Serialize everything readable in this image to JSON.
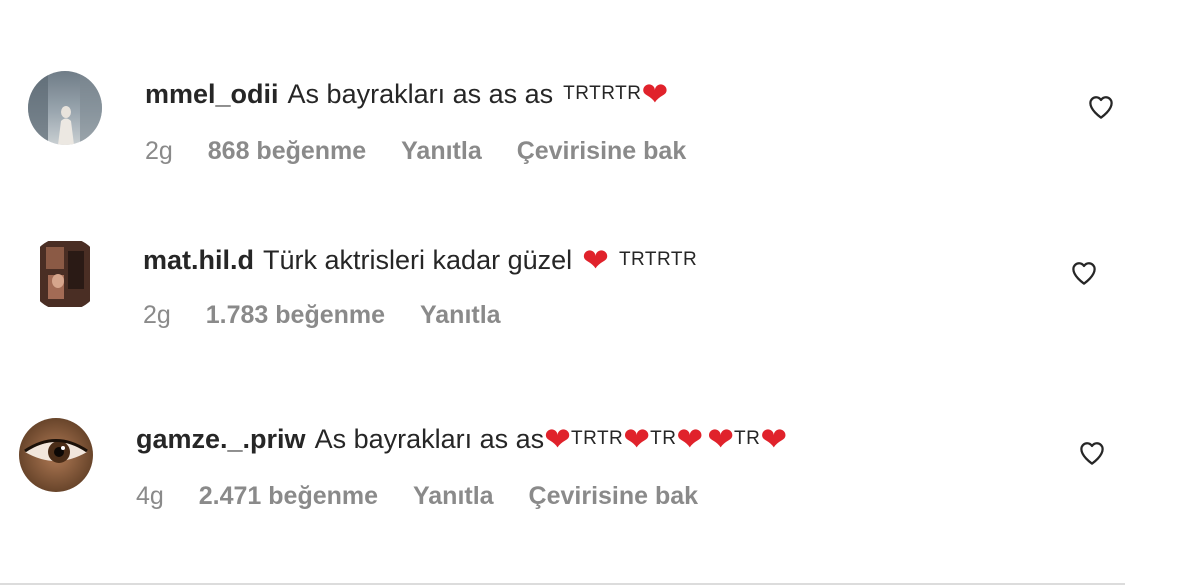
{
  "comments": [
    {
      "username": "mmel_odii",
      "text": "As bayrakları as as as",
      "tr_label": "TRTRTR",
      "time": "2g",
      "likes": "868 beğenme",
      "reply": "Yanıtla",
      "translate": "Çevirisine bak",
      "avatar_icon": "profile-photo-avatar"
    },
    {
      "username": "mat.hil.d",
      "text": "Türk aktrisleri kadar güzel",
      "tr_label": "TRTRTR",
      "time": "2g",
      "likes": "1.783 beğenme",
      "reply": "Yanıtla",
      "avatar_icon": "profile-photo-avatar"
    },
    {
      "username": "gamze._.priw",
      "text": "As bayrakları as as",
      "tr_1": "TRTR",
      "tr_2": "TR",
      "tr_3": "TR",
      "time": "4g",
      "likes": "2.471 beğenme",
      "reply": "Yanıtla",
      "translate": "Çevirisine bak",
      "avatar_icon": "eye-photo-avatar"
    }
  ],
  "colors": {
    "text": "#262626",
    "meta": "#8a8a8a",
    "heart_emoji": "#e0222b",
    "like_icon_stroke": "#262626"
  },
  "icons": {
    "like": "heart-outline-icon",
    "emoji": "red-heart-emoji"
  }
}
